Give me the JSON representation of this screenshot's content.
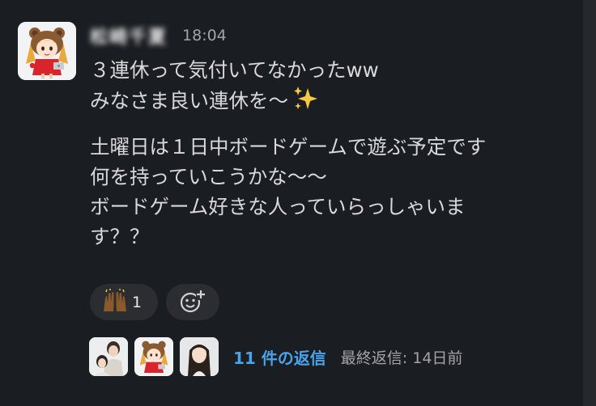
{
  "message": {
    "sender_name": "松崎千夏",
    "timestamp": "18:04",
    "paragraphs": [
      {
        "lines": [
          "３連休って気付いてなかったww",
          "みなさま良い連休を〜"
        ]
      },
      {
        "lines": [
          "土曜日は１日中ボードゲームで遊ぶ予定です",
          "何を持っていこうかな〜〜",
          "ボードゲーム好きな人っていらっしゃいま",
          "す？？"
        ]
      }
    ]
  },
  "reactions": [
    {
      "emoji": "raised-hands-icon",
      "count": "1"
    }
  ],
  "add_reaction": {
    "icon": "add-emoji-icon"
  },
  "thread": {
    "replies_label": "11 件の返信",
    "last_reply_label": "最終返信: 14日前"
  },
  "colors": {
    "background": "#1a1d21",
    "link": "#4aa2e8",
    "muted": "#a3a4a6",
    "reaction_bg": "#2b2d31"
  }
}
